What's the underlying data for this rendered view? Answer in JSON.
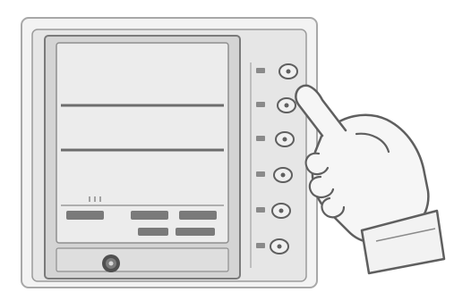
{
  "device": {
    "screen_text": {
      "row1_left": "",
      "row1_mid": "",
      "row1_right": "",
      "row2_mid": "",
      "row2_right": ""
    },
    "button_count": 6
  },
  "colors": {
    "frame": "#d9d9d9",
    "frame_edge": "#8a8a8a",
    "screen": "#ececec",
    "screen_border": "#9a9a9a",
    "line": "#6d6d6d",
    "hand": "#f6f6f6",
    "outline": "#5f5f5f"
  },
  "icons": {
    "bottom_knob": "round-knob-icon",
    "hand": "pointing-hand-icon"
  }
}
